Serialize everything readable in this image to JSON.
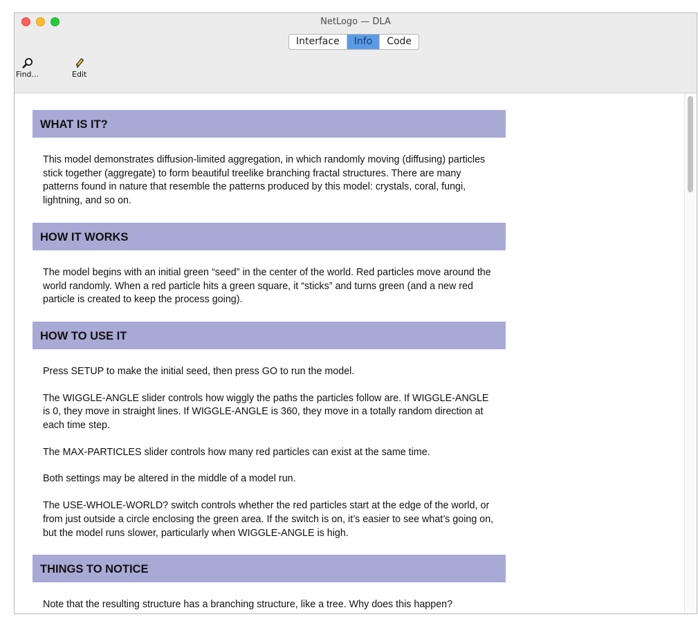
{
  "window": {
    "title": "NetLogo — DLA"
  },
  "tabs": [
    {
      "label": "Interface",
      "active": false
    },
    {
      "label": "Info",
      "active": true
    },
    {
      "label": "Code",
      "active": false
    }
  ],
  "toolbar": {
    "find": {
      "label": "Find...",
      "icon": "magnifier-icon"
    },
    "edit": {
      "label": "Edit",
      "icon": "pencil-icon"
    }
  },
  "sections": [
    {
      "heading": "WHAT IS IT?",
      "paragraphs": [
        "This model demonstrates diffusion-limited aggregation, in which randomly moving (diffusing) particles stick together (aggregate) to form beautiful treelike branching fractal structures. There are many patterns found in nature that resemble the patterns produced by this model: crystals, coral, fungi, lightning, and so on."
      ]
    },
    {
      "heading": "HOW IT WORKS",
      "paragraphs": [
        "The model begins with an initial green “seed” in the center of the world. Red particles move around the world randomly. When a red particle hits a green square, it “sticks” and turns green (and a new red particle is created to keep the process going)."
      ]
    },
    {
      "heading": "HOW TO USE IT",
      "paragraphs": [
        "Press SETUP to make the initial seed, then press GO to run the model.",
        "The WIGGLE-ANGLE slider controls how wiggly the paths the particles follow are. If WIGGLE-ANGLE is 0, they move in straight lines. If WIGGLE-ANGLE is 360, they move in a totally random direction at each time step.",
        "The MAX-PARTICLES slider controls how many red particles can exist at the same time.",
        "Both settings may be altered in the middle of a model run.",
        "The USE-WHOLE-WORLD? switch controls whether the red particles start at the edge of the world, or from just outside a circle enclosing the green area. If the switch is on, it’s easier to see what’s going on, but the model runs slower, particularly when WIGGLE-ANGLE is high."
      ]
    },
    {
      "heading": "THINGS TO NOTICE",
      "paragraphs": [
        "Note that the resulting structure has a branching structure, like a tree. Why does this happen?"
      ]
    }
  ],
  "colors": {
    "section_heading_bg": "#a9a9d6",
    "active_tab_bg": "#5b9be6"
  }
}
